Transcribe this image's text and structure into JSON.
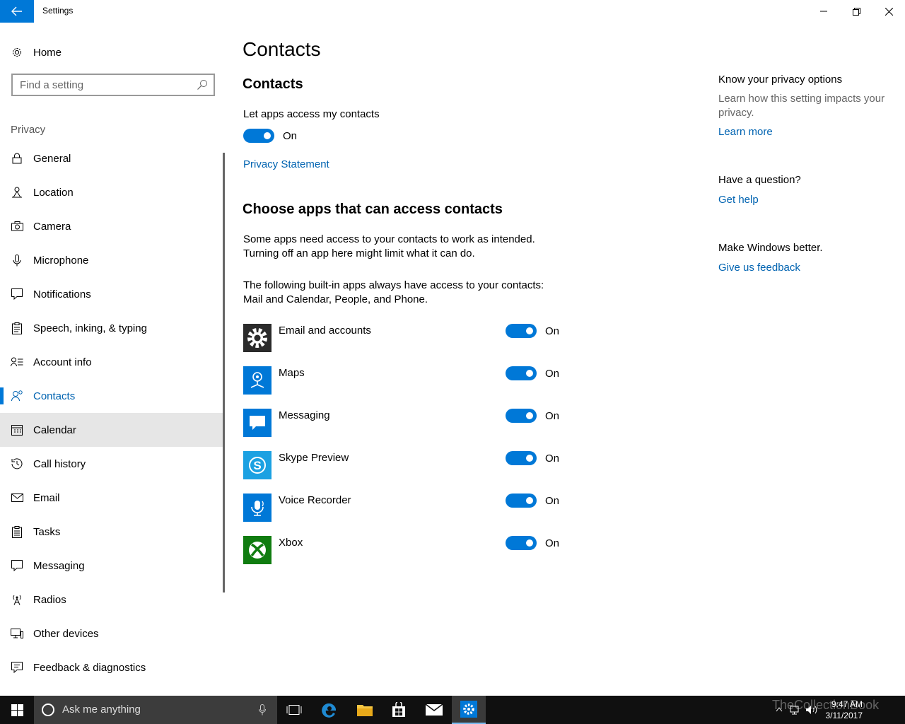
{
  "window": {
    "title": "Settings",
    "back_icon": "arrow-left-icon",
    "controls": [
      "minimize-icon",
      "restore-icon",
      "close-icon"
    ]
  },
  "sidebar": {
    "home_label": "Home",
    "search_placeholder": "Find a setting",
    "section_label": "Privacy",
    "items": [
      {
        "label": "General",
        "icon": "lock-icon"
      },
      {
        "label": "Location",
        "icon": "location-icon"
      },
      {
        "label": "Camera",
        "icon": "camera-icon"
      },
      {
        "label": "Microphone",
        "icon": "microphone-icon"
      },
      {
        "label": "Notifications",
        "icon": "notifications-icon"
      },
      {
        "label": "Speech, inking, & typing",
        "icon": "speech-icon"
      },
      {
        "label": "Account info",
        "icon": "account-info-icon"
      },
      {
        "label": "Contacts",
        "icon": "contacts-icon",
        "active": true
      },
      {
        "label": "Calendar",
        "icon": "calendar-icon",
        "hover": true
      },
      {
        "label": "Call history",
        "icon": "history-icon"
      },
      {
        "label": "Email",
        "icon": "email-icon"
      },
      {
        "label": "Tasks",
        "icon": "tasks-icon"
      },
      {
        "label": "Messaging",
        "icon": "messaging-icon"
      },
      {
        "label": "Radios",
        "icon": "radios-icon"
      },
      {
        "label": "Other devices",
        "icon": "other-devices-icon"
      },
      {
        "label": "Feedback & diagnostics",
        "icon": "feedback-icon"
      }
    ]
  },
  "main": {
    "page_title": "Contacts",
    "section_title": "Contacts",
    "access_label": "Let apps access my contacts",
    "access_state": "On",
    "privacy_link": "Privacy Statement",
    "choose_title": "Choose apps that can access contacts",
    "desc_line1": "Some apps need access to your contacts to work as intended.",
    "desc_line2": "Turning off an app here might limit what it can do.",
    "builtin_line1": "The following built-in apps always have access to your contacts:",
    "builtin_line2": "Mail and Calendar, People, and Phone.",
    "apps": [
      {
        "name": "Email and accounts",
        "state": "On",
        "tile_color": "#2b2b2b",
        "icon": "gear-icon"
      },
      {
        "name": "Maps",
        "state": "On",
        "tile_color": "#0078d7",
        "icon": "maps-icon"
      },
      {
        "name": "Messaging",
        "state": "On",
        "tile_color": "#0078d7",
        "icon": "message-bubble-icon"
      },
      {
        "name": "Skype Preview",
        "state": "On",
        "tile_color": "#1ba1e2",
        "icon": "skype-icon"
      },
      {
        "name": "Voice Recorder",
        "state": "On",
        "tile_color": "#0078d7",
        "icon": "voice-recorder-icon"
      },
      {
        "name": "Xbox",
        "state": "On",
        "tile_color": "#107c10",
        "icon": "xbox-icon"
      }
    ]
  },
  "aside": {
    "privacy_heading": "Know your privacy options",
    "privacy_text": "Learn how this setting impacts your privacy.",
    "learn_more": "Learn more",
    "question_heading": "Have a question?",
    "get_help": "Get help",
    "better_heading": "Make Windows better.",
    "feedback_link": "Give us feedback"
  },
  "taskbar": {
    "search_placeholder": "Ask me anything",
    "time": "9:47 AM",
    "date": "3/11/2017",
    "watermark": "TheCollectionBook"
  },
  "colors": {
    "accent": "#0078d7",
    "link": "#0063b1",
    "taskbar": "#101010"
  }
}
